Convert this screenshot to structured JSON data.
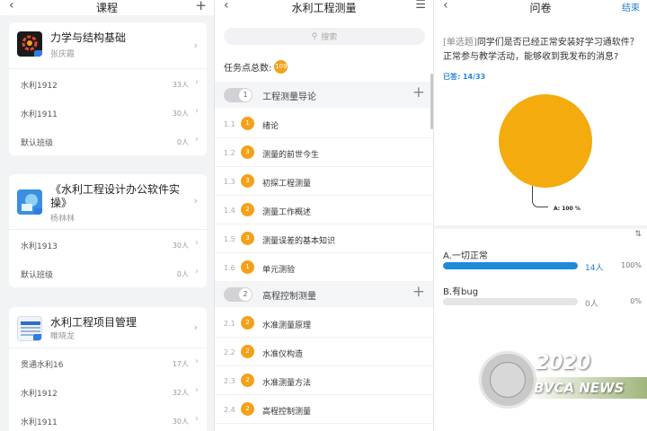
{
  "courses_panel": {
    "title": "课程",
    "courses": [
      {
        "title": "力学与结构基础",
        "teacher": "张庆霞",
        "logo": "sunflower-logo",
        "classes": [
          {
            "name": "水利1912",
            "count": "33人"
          },
          {
            "name": "水利1911",
            "count": "30人"
          },
          {
            "name": "默认班级",
            "count": "0人"
          }
        ]
      },
      {
        "title": "《水利工程设计办公软件实操》",
        "teacher": "杨林林",
        "logo": "office-logo",
        "classes": [
          {
            "name": "水利1913",
            "count": "30人"
          },
          {
            "name": "默认班级",
            "count": "0人"
          }
        ]
      },
      {
        "title": "水利工程项目管理",
        "teacher": "睢晓龙",
        "logo": "book-logo",
        "classes": [
          {
            "name": "贯通水利16",
            "count": "17人"
          },
          {
            "name": "水利1912",
            "count": "32人"
          },
          {
            "name": "水利1911",
            "count": "30人"
          }
        ]
      }
    ]
  },
  "outline_panel": {
    "title": "水利工程测量",
    "search_placeholder": "搜索",
    "total_label": "任务点总数:",
    "total_count": "109",
    "chapters": [
      {
        "number": "1",
        "title": "工程测量导论",
        "lessons": [
          {
            "num": "1.1",
            "badge": "1",
            "title": "绪论"
          },
          {
            "num": "1.2",
            "badge": "3",
            "title": "测量的前世今生"
          },
          {
            "num": "1.3",
            "badge": "3",
            "title": "初探工程测量"
          },
          {
            "num": "1.4",
            "badge": "2",
            "title": "测量工作概述"
          },
          {
            "num": "1.5",
            "badge": "3",
            "title": "测量误差的基本知识"
          },
          {
            "num": "1.6",
            "badge": "1",
            "title": "单元测验"
          }
        ]
      },
      {
        "number": "2",
        "title": "高程控制测量",
        "lessons": [
          {
            "num": "2.1",
            "badge": "2",
            "title": "水准测量原理"
          },
          {
            "num": "2.2",
            "badge": "2",
            "title": "水准仪构造"
          },
          {
            "num": "2.3",
            "badge": "2",
            "title": "水准测量方法"
          },
          {
            "num": "2.4",
            "badge": "2",
            "title": "高程控制测量"
          }
        ]
      }
    ]
  },
  "survey_panel": {
    "title": "问卷",
    "end_label": "结束",
    "question_type": "[单选题]",
    "question_text": "同学们是否已经正常安装好学习通软件？正常参与教学活动，能够收到我发布的消息?",
    "answered": "已答: 14/33",
    "pie_label": "A: 100 %",
    "pie_color": "#f3ab0d",
    "options": [
      {
        "name": "A.一切正常",
        "count": "14人",
        "percent": "100%",
        "fraction": 1.0
      },
      {
        "name": "B.有bug",
        "count": "0人",
        "percent": "0%",
        "fraction": 0.0
      }
    ]
  },
  "watermark": {
    "year": "2020",
    "name": "BVCA NEWS"
  }
}
